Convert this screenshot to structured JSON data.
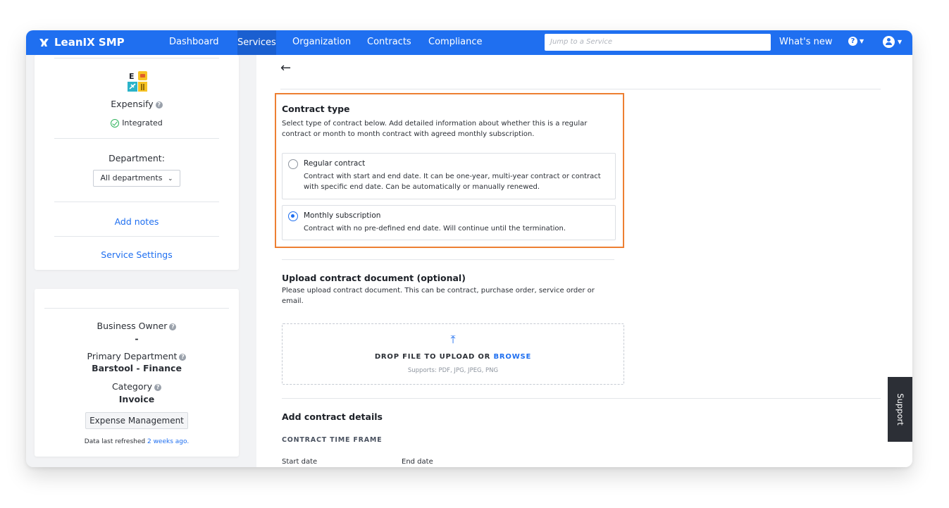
{
  "nav": {
    "logo": "LeanIX SMP",
    "links": [
      "Dashboard",
      "Services",
      "Organization",
      "Contracts",
      "Compliance"
    ],
    "active": "Services",
    "search_placeholder": "Jump to a Service",
    "whats_new": "What's new"
  },
  "sidebar": {
    "app_name": "Expensify",
    "status": "Integrated",
    "department_label": "Department:",
    "department_value": "All departments",
    "add_notes": "Add notes",
    "service_settings": "Service Settings",
    "business_owner_label": "Business Owner",
    "business_owner_value": "-",
    "primary_department_label": "Primary Department",
    "primary_department_value": "Barstool - Finance",
    "category_label": "Category",
    "category_value": "Invoice",
    "tag": "Expense Management",
    "refreshed_prefix": "Data last refreshed",
    "refreshed_link": "2 weeks ago."
  },
  "contract_type": {
    "title": "Contract type",
    "description": "Select type of contract below. Add detailed information about whether this is a regular contract or month to month contract with agreed monthly subscription.",
    "options": [
      {
        "title": "Regular contract",
        "description": "Contract with start and end date. It can be one-year, multi-year contract or contract with specific end date. Can be automatically or manually renewed.",
        "selected": false
      },
      {
        "title": "Monthly subscription",
        "description": "Contract with no pre-defined end date. Will continue until the termination.",
        "selected": true
      }
    ]
  },
  "upload": {
    "title": "Upload contract document (optional)",
    "description": "Please upload contract document. This can be contract, purchase order, service order or email.",
    "drop_text": "DROP FILE TO UPLOAD OR",
    "browse": "BROWSE",
    "supports": "Supports: PDF, JPG, JPEG, PNG"
  },
  "details": {
    "title": "Add contract details",
    "section": "CONTRACT TIME FRAME",
    "start_date_label": "Start date",
    "end_date_label": "End date"
  },
  "support": "Support",
  "colors": {
    "nav": "#1f6ff0",
    "highlight": "#ed7f32",
    "link": "#1f6ff0"
  }
}
